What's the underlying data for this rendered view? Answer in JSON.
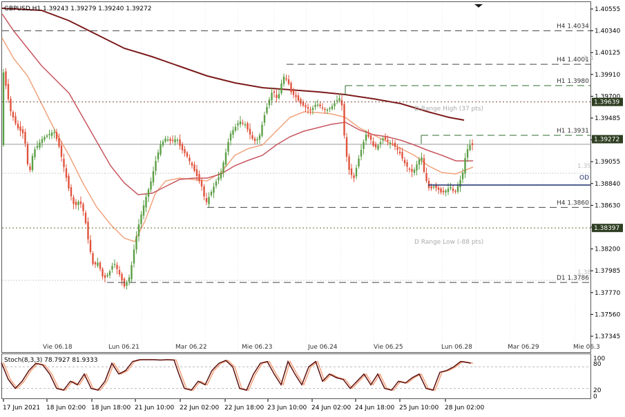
{
  "header": {
    "title": "GBPUSD,H1  1.39243 1.39279 1.39240 1.39272"
  },
  "colors": {
    "bull": "#5b9e45",
    "bear": "#e0533c",
    "ma_fast": "#f1a27c",
    "ma_mid": "#c8555f",
    "ma_slow": "#7c1a1a",
    "level": "#2d6b2d",
    "current_price_bg": "#2e3e21",
    "stoch_main": "#5a0f0f",
    "stoch_signal": "#f3a079"
  },
  "price_axis": {
    "ticks": [
      "1.40555",
      "1.40340",
      "1.40125",
      "1.39910",
      "1.39700",
      "1.39485",
      "1.39270",
      "1.39055",
      "1.38840",
      "1.38630",
      "1.38415",
      "1.38200",
      "1.37985",
      "1.37770",
      "1.37560",
      "1.37345"
    ],
    "highlights": [
      {
        "id": "range-high-price",
        "label": "1.39639",
        "value": 1.39639
      },
      {
        "id": "current-price",
        "label": "1.39272",
        "value": 1.39272
      },
      {
        "id": "range-low-price",
        "label": "1.38397",
        "value": 1.38397
      }
    ]
  },
  "levels": [
    {
      "id": "h4-1-4034",
      "label": "H4 1.4034",
      "value": 1.4034
    },
    {
      "id": "h4-1-4001",
      "label": "H4 1.4001",
      "value": 1.4001
    },
    {
      "id": "h1-1-3980",
      "label": "H1 1.3980",
      "value": 1.398
    },
    {
      "id": "h1-1-3931",
      "label": "H1 1.3931",
      "value": 1.3931
    },
    {
      "id": "h4-1-3860",
      "label": "H4 1.3860",
      "value": 1.386
    },
    {
      "id": "d1-1-3786",
      "label": "D1 1.3786",
      "value": 1.3786
    }
  ],
  "range_lines": {
    "high_label": "D Range High (37 pts)",
    "low_label": "D Range Low (-88 pts)",
    "od_label": "OD",
    "mark_139": "1.39",
    "mark_138": "1.38",
    "mark_14": "1.4"
  },
  "day_labels": [
    "Vie 06.18",
    "Lun 06.21",
    "Mar 06.22",
    "Mie 06.23",
    "Jue 06.24",
    "Vie 06.25",
    "Lun 06.28",
    "Mar 06.29",
    "Mie 06.3"
  ],
  "stochastic": {
    "label": "Stoch(8,3,3) 78.7927 81.9333",
    "scale": [
      "100",
      "80",
      "20",
      "0"
    ]
  },
  "time_axis": [
    "17 Jun 2021",
    "18 Jun 02:00",
    "18 Jun 18:00",
    "21 Jun 10:00",
    "22 Jun 02:00",
    "22 Jun 18:00",
    "23 Jun 10:00",
    "24 Jun 02:00",
    "24 Jun 18:00",
    "25 Jun 10:00",
    "28 Jun 02:00"
  ]
}
